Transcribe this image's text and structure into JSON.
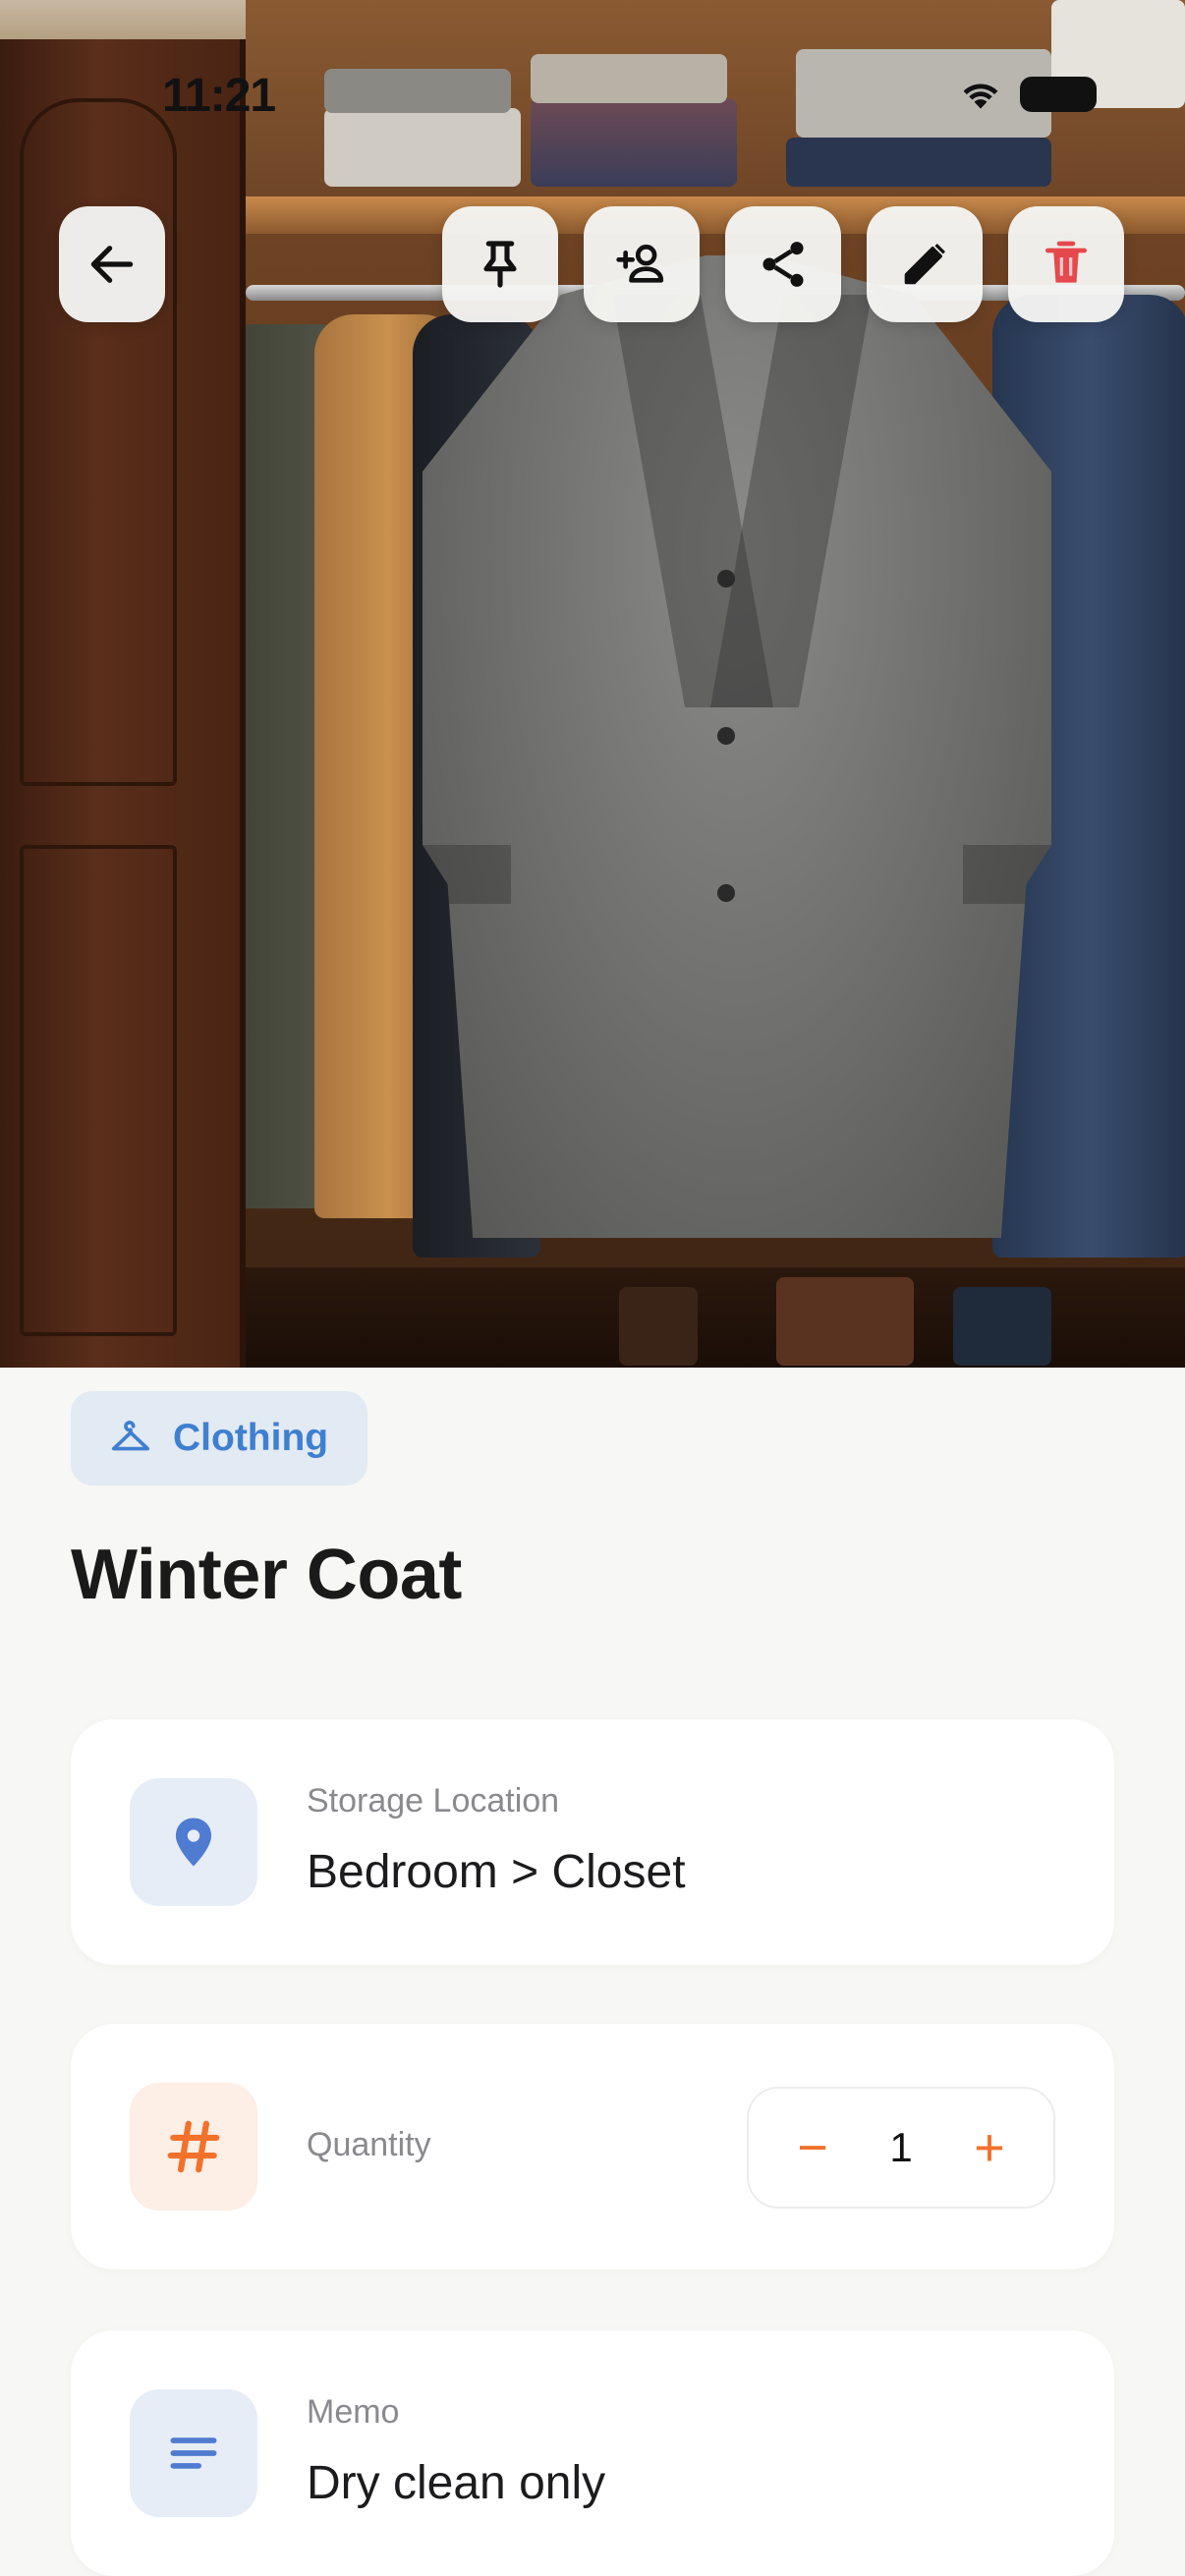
{
  "status_bar": {
    "time": "11:21"
  },
  "toolbar": {
    "back": {
      "icon": "arrow-left-icon"
    },
    "actions": [
      {
        "id": "pin",
        "icon": "pin-icon"
      },
      {
        "id": "add-person",
        "icon": "person-add-icon"
      },
      {
        "id": "share",
        "icon": "share-icon"
      },
      {
        "id": "edit",
        "icon": "pencil-icon"
      },
      {
        "id": "delete",
        "icon": "trash-icon",
        "color": "#e5484d"
      }
    ]
  },
  "item": {
    "category": {
      "label": "Clothing",
      "icon": "hanger-icon",
      "color": "#3f7fd0"
    },
    "title": "Winter Coat"
  },
  "cards": {
    "location": {
      "label": "Storage Location",
      "value": "Bedroom > Closet",
      "icon": "location-pin-icon",
      "color": "#4f7bd0"
    },
    "quantity": {
      "label": "Quantity",
      "value": "1",
      "decrement": "−",
      "increment": "+",
      "icon": "hash-icon",
      "color": "#f2722b"
    },
    "memo": {
      "label": "Memo",
      "value": "Dry clean only",
      "icon": "notes-icon",
      "color": "#4f7bd0"
    }
  }
}
